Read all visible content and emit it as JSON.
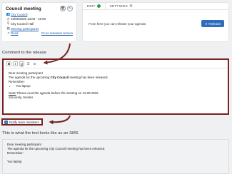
{
  "meeting": {
    "title": "Council meeting",
    "rows": [
      {
        "icon": "people-icon",
        "glyph": "👥",
        "text": "City Council",
        "link": true
      },
      {
        "icon": "clock-icon",
        "glyph": "◷",
        "text": "15/09/2025 13:00 - 15:00",
        "link": false
      },
      {
        "icon": "location-icon",
        "glyph": "⚲",
        "text": "City Council Hall",
        "link": false
      },
      {
        "icon": "document-icon",
        "glyph": "▤",
        "text": "Meeting participants",
        "link": true
      }
    ],
    "read_icon": "external-link-icon",
    "read_label": "Read",
    "released_link": "Go to released version"
  },
  "tabs": {
    "edit_label": "EDIT",
    "settings_label": "SETTINGS",
    "release_message": "From here you can release your agenda",
    "release_button": "Release"
  },
  "comment": {
    "title": "Comment to the release",
    "toolbar": {
      "bold": "B",
      "italic": "I",
      "underline": "U"
    },
    "lines": {
      "greeting": "Dear meeting participant",
      "line1_pre": "The agenda for the upcoming ",
      "line1_bold": "City Council",
      "line1_post": " meeting has been released.",
      "remember": "Remember:",
      "bullet": "You laptop",
      "note_label": "Note!",
      "note_text": " Please read the agenda before the meeting on 15.09.2025",
      "closing": "Sincerely, Sender"
    }
  },
  "notify": {
    "label": "Notify team members",
    "checked": true
  },
  "sms": {
    "title": "This is what the text looks like as an SMS",
    "lines": {
      "greeting": "Dear meeting participant",
      "line1": "The agenda for the upcoming City Council meeting has been released.",
      "remember": "Remember:",
      "bullet": "You laptop"
    }
  },
  "colors": {
    "accent": "#2f6dbf",
    "annotation": "#7a2020",
    "status_green": "#2e9e4f"
  }
}
